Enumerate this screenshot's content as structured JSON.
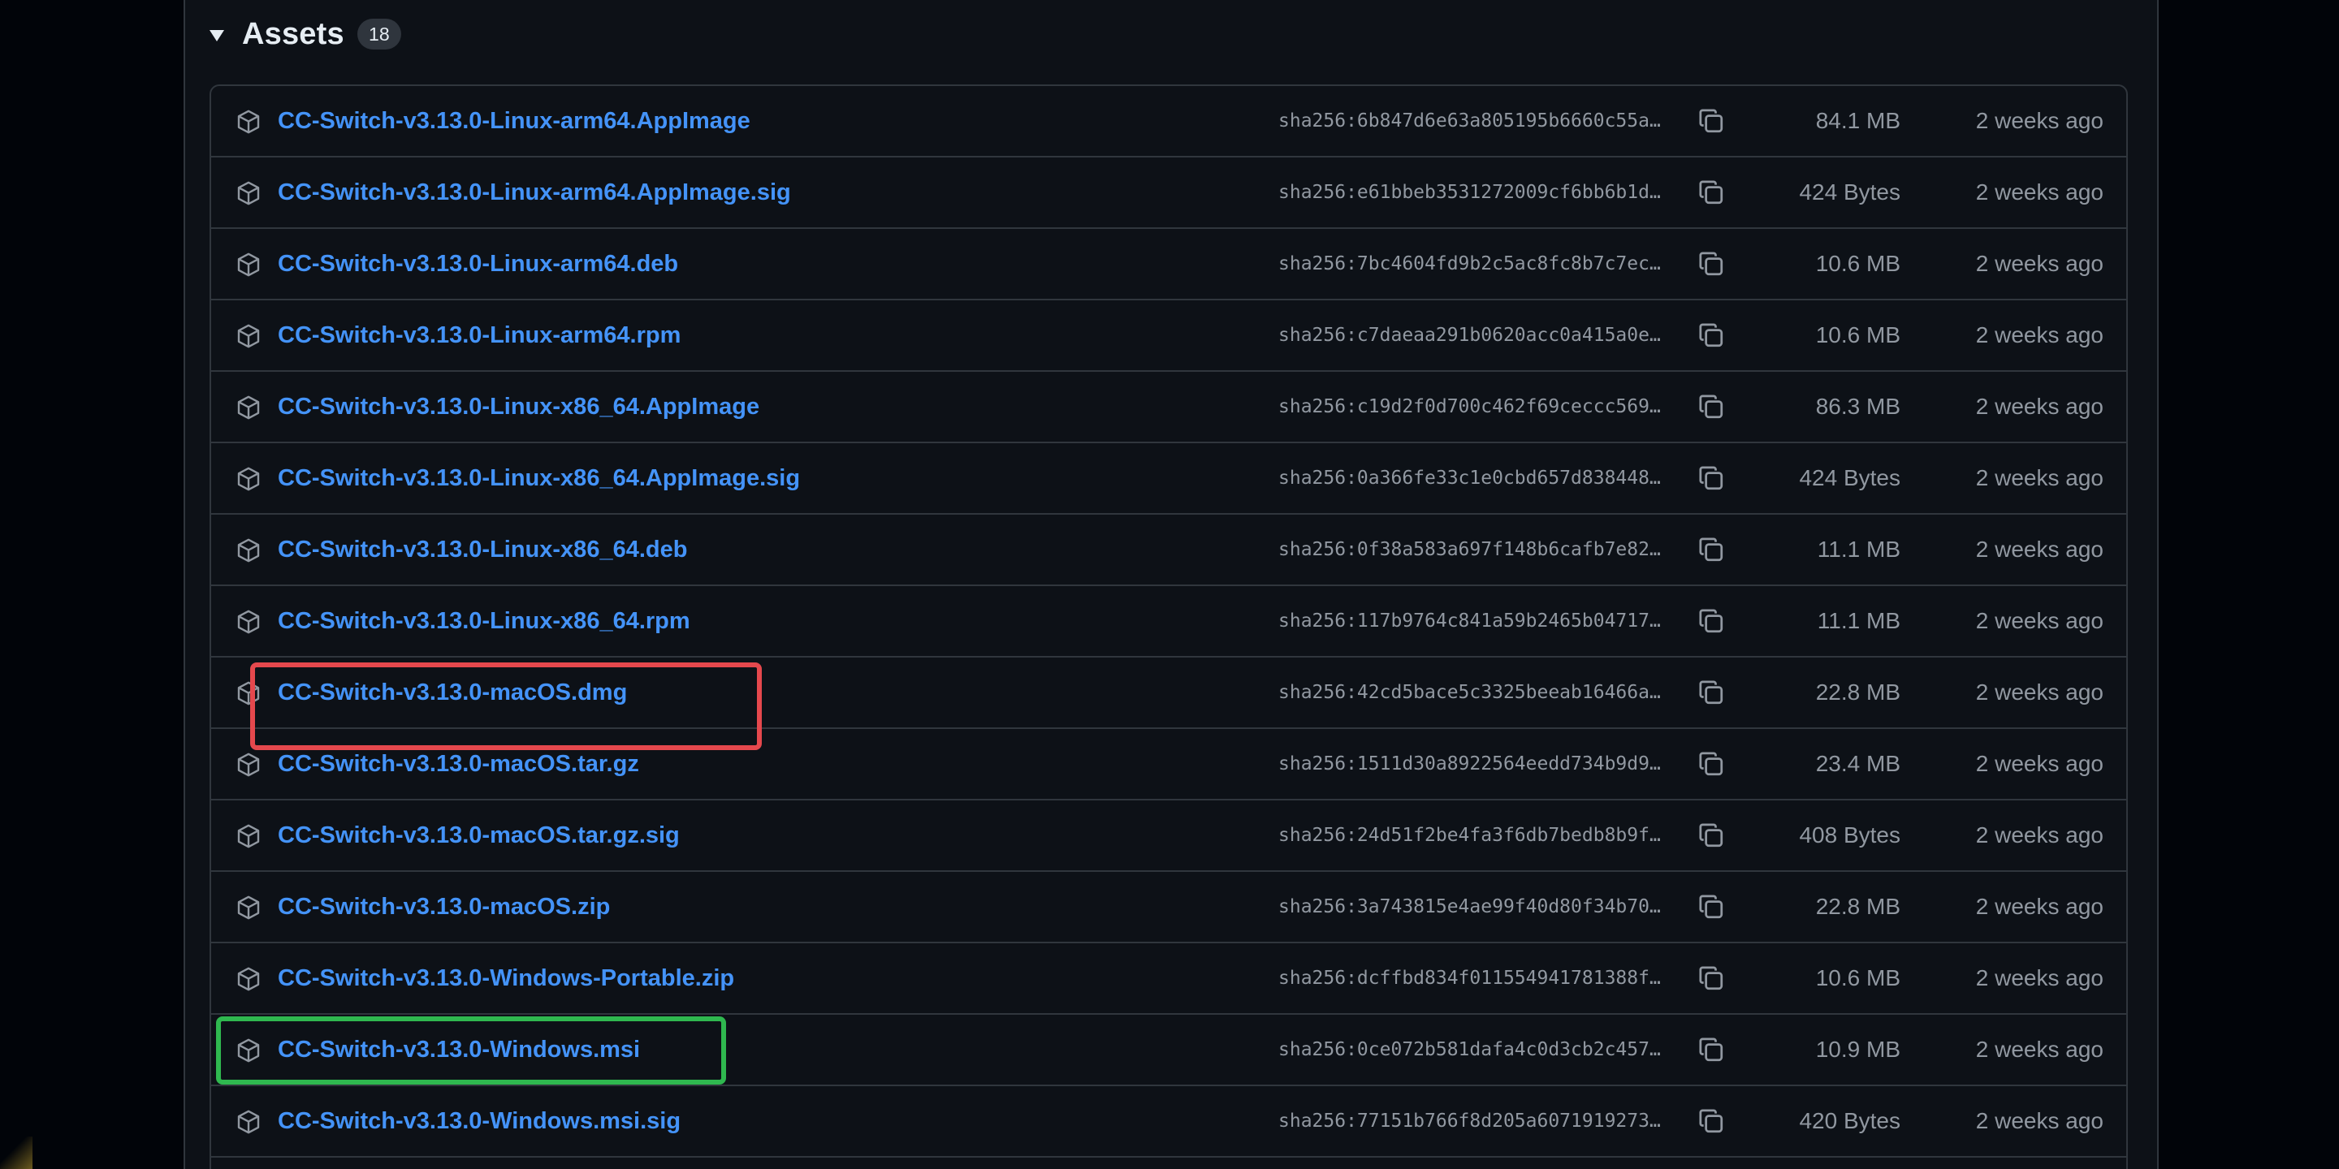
{
  "assets": {
    "title": "Assets",
    "count": "18",
    "items": [
      {
        "name": "CC-Switch-v3.13.0-Linux-arm64.AppImage",
        "sha": "sha256:6b847d6e63a805195b6660c55a…",
        "size": "84.1 MB",
        "date": "2 weeks ago"
      },
      {
        "name": "CC-Switch-v3.13.0-Linux-arm64.AppImage.sig",
        "sha": "sha256:e61bbeb3531272009cf6bb6b1d…",
        "size": "424 Bytes",
        "date": "2 weeks ago"
      },
      {
        "name": "CC-Switch-v3.13.0-Linux-arm64.deb",
        "sha": "sha256:7bc4604fd9b2c5ac8fc8b7c7ec…",
        "size": "10.6 MB",
        "date": "2 weeks ago"
      },
      {
        "name": "CC-Switch-v3.13.0-Linux-arm64.rpm",
        "sha": "sha256:c7daeaa291b0620acc0a415a0e…",
        "size": "10.6 MB",
        "date": "2 weeks ago"
      },
      {
        "name": "CC-Switch-v3.13.0-Linux-x86_64.AppImage",
        "sha": "sha256:c19d2f0d700c462f69ceccc569…",
        "size": "86.3 MB",
        "date": "2 weeks ago"
      },
      {
        "name": "CC-Switch-v3.13.0-Linux-x86_64.AppImage.sig",
        "sha": "sha256:0a366fe33c1e0cbd657d838448…",
        "size": "424 Bytes",
        "date": "2 weeks ago"
      },
      {
        "name": "CC-Switch-v3.13.0-Linux-x86_64.deb",
        "sha": "sha256:0f38a583a697f148b6cafb7e82…",
        "size": "11.1 MB",
        "date": "2 weeks ago"
      },
      {
        "name": "CC-Switch-v3.13.0-Linux-x86_64.rpm",
        "sha": "sha256:117b9764c841a59b2465b04717…",
        "size": "11.1 MB",
        "date": "2 weeks ago"
      },
      {
        "name": "CC-Switch-v3.13.0-macOS.dmg",
        "sha": "sha256:42cd5bace5c3325beeab16466a…",
        "size": "22.8 MB",
        "date": "2 weeks ago"
      },
      {
        "name": "CC-Switch-v3.13.0-macOS.tar.gz",
        "sha": "sha256:1511d30a8922564eedd734b9d9…",
        "size": "23.4 MB",
        "date": "2 weeks ago"
      },
      {
        "name": "CC-Switch-v3.13.0-macOS.tar.gz.sig",
        "sha": "sha256:24d51f2be4fa3f6db7bedb8b9f…",
        "size": "408 Bytes",
        "date": "2 weeks ago"
      },
      {
        "name": "CC-Switch-v3.13.0-macOS.zip",
        "sha": "sha256:3a743815e4ae99f40d80f34b70…",
        "size": "22.8 MB",
        "date": "2 weeks ago"
      },
      {
        "name": "CC-Switch-v3.13.0-Windows-Portable.zip",
        "sha": "sha256:dcffbd834f011554941781388f…",
        "size": "10.6 MB",
        "date": "2 weeks ago"
      },
      {
        "name": "CC-Switch-v3.13.0-Windows.msi",
        "sha": "sha256:0ce072b581dafa4c0d3cb2c457…",
        "size": "10.9 MB",
        "date": "2 weeks ago"
      },
      {
        "name": "CC-Switch-v3.13.0-Windows.msi.sig",
        "sha": "sha256:77151b766f8d205a6071919273…",
        "size": "420 Bytes",
        "date": "2 weeks ago"
      }
    ]
  },
  "icons": {
    "row_icon": "package-icon",
    "copy_icon": "copy-icon",
    "toggle_icon": "caret-down-icon"
  },
  "highlights": [
    {
      "target": "CC-Switch-v3.13.0-macOS.dmg",
      "color": "#e5484d"
    },
    {
      "target": "CC-Switch-v3.13.0-Windows.msi",
      "color": "#2fb84f"
    }
  ],
  "colors": {
    "link": "#4493f8",
    "muted": "#9198a1",
    "border": "#30363d",
    "panel": "#0d1117",
    "page": "#010409"
  }
}
